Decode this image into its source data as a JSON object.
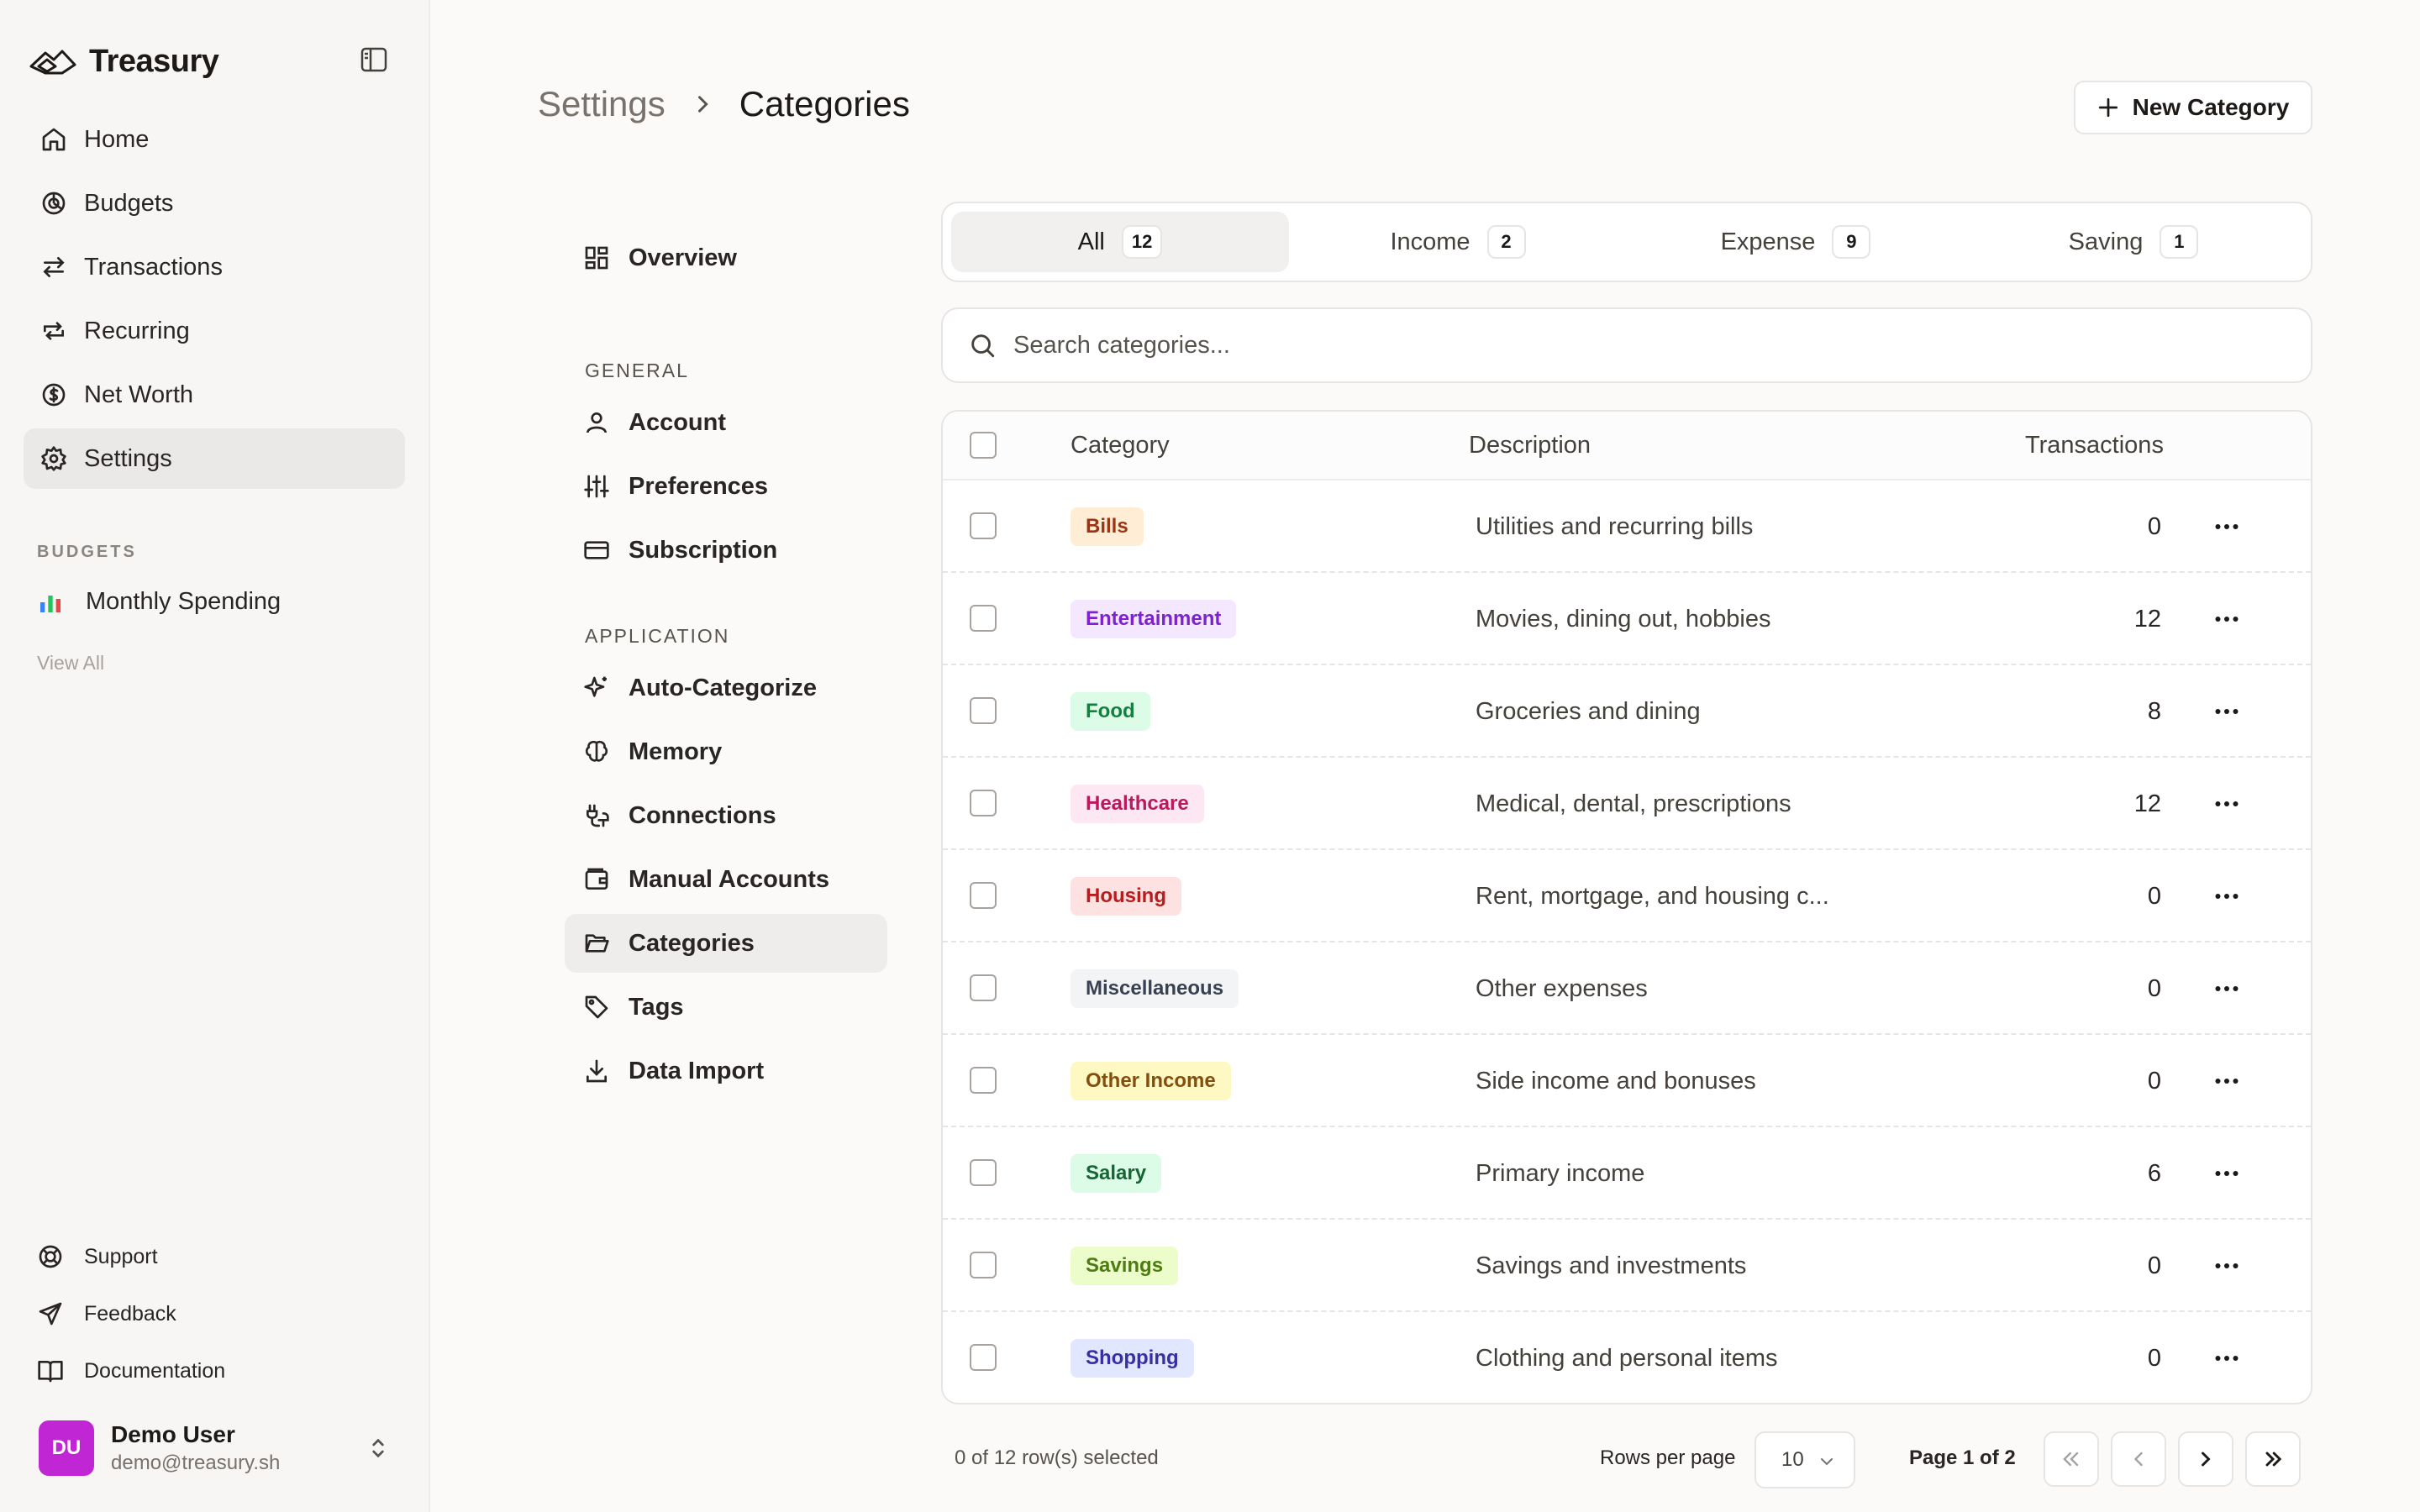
{
  "app": {
    "name": "Treasury"
  },
  "sidebar": {
    "nav": [
      {
        "label": "Home",
        "icon": "home-icon"
      },
      {
        "label": "Budgets",
        "icon": "pie-icon"
      },
      {
        "label": "Transactions",
        "icon": "arrows-icon"
      },
      {
        "label": "Recurring",
        "icon": "repeat-icon"
      },
      {
        "label": "Net Worth",
        "icon": "dollar-circle-icon"
      },
      {
        "label": "Settings",
        "icon": "gear-icon",
        "active": true
      }
    ],
    "budgets_label": "BUDGETS",
    "budget_item": "Monthly Spending",
    "view_all": "View All",
    "footer": [
      {
        "label": "Support",
        "icon": "lifebuoy-icon"
      },
      {
        "label": "Feedback",
        "icon": "send-icon"
      },
      {
        "label": "Documentation",
        "icon": "book-icon"
      }
    ],
    "user": {
      "initials": "DU",
      "name": "Demo User",
      "email": "demo@treasury.sh"
    }
  },
  "header": {
    "breadcrumb_parent": "Settings",
    "breadcrumb_current": "Categories",
    "new_button": "New Category"
  },
  "subnav": {
    "overview": "Overview",
    "general_label": "GENERAL",
    "general": [
      "Account",
      "Preferences",
      "Subscription"
    ],
    "application_label": "APPLICATION",
    "application": [
      "Auto-Categorize",
      "Memory",
      "Connections",
      "Manual Accounts",
      "Categories",
      "Tags",
      "Data Import"
    ]
  },
  "tabs": [
    {
      "label": "All",
      "count": "12",
      "active": true
    },
    {
      "label": "Income",
      "count": "2"
    },
    {
      "label": "Expense",
      "count": "9"
    },
    {
      "label": "Saving",
      "count": "1"
    }
  ],
  "search": {
    "placeholder": "Search categories..."
  },
  "table": {
    "columns": {
      "category": "Category",
      "description": "Description",
      "transactions": "Transactions"
    },
    "rows": [
      {
        "name": "Bills",
        "description": "Utilities and recurring bills",
        "count": "0",
        "bg": "#ffedd5",
        "fg": "#9a3412"
      },
      {
        "name": "Entertainment",
        "description": "Movies, dining out, hobbies",
        "count": "12",
        "bg": "#f3e8ff",
        "fg": "#7e22ce"
      },
      {
        "name": "Food",
        "description": "Groceries and dining",
        "count": "8",
        "bg": "#dcfce7",
        "fg": "#15803d"
      },
      {
        "name": "Healthcare",
        "description": "Medical, dental, prescriptions",
        "count": "12",
        "bg": "#fce7f3",
        "fg": "#be185d"
      },
      {
        "name": "Housing",
        "description": "Rent, mortgage, and housing c...",
        "count": "0",
        "bg": "#fee2e2",
        "fg": "#b91c1c"
      },
      {
        "name": "Miscellaneous",
        "description": "Other expenses",
        "count": "0",
        "bg": "#f3f4f6",
        "fg": "#374151"
      },
      {
        "name": "Other Income",
        "description": "Side income and bonuses",
        "count": "0",
        "bg": "#fef9c3",
        "fg": "#854d0e"
      },
      {
        "name": "Salary",
        "description": "Primary income",
        "count": "6",
        "bg": "#dcfce7",
        "fg": "#166534"
      },
      {
        "name": "Savings",
        "description": "Savings and investments",
        "count": "0",
        "bg": "#ecfccb",
        "fg": "#4d7c0f"
      },
      {
        "name": "Shopping",
        "description": "Clothing and personal items",
        "count": "0",
        "bg": "#e0e7ff",
        "fg": "#3730a3"
      }
    ]
  },
  "pagination": {
    "selected": "0 of 12 row(s) selected",
    "rows_per_page_label": "Rows per page",
    "rows_per_page": "10",
    "page_info": "Page 1 of 2"
  }
}
